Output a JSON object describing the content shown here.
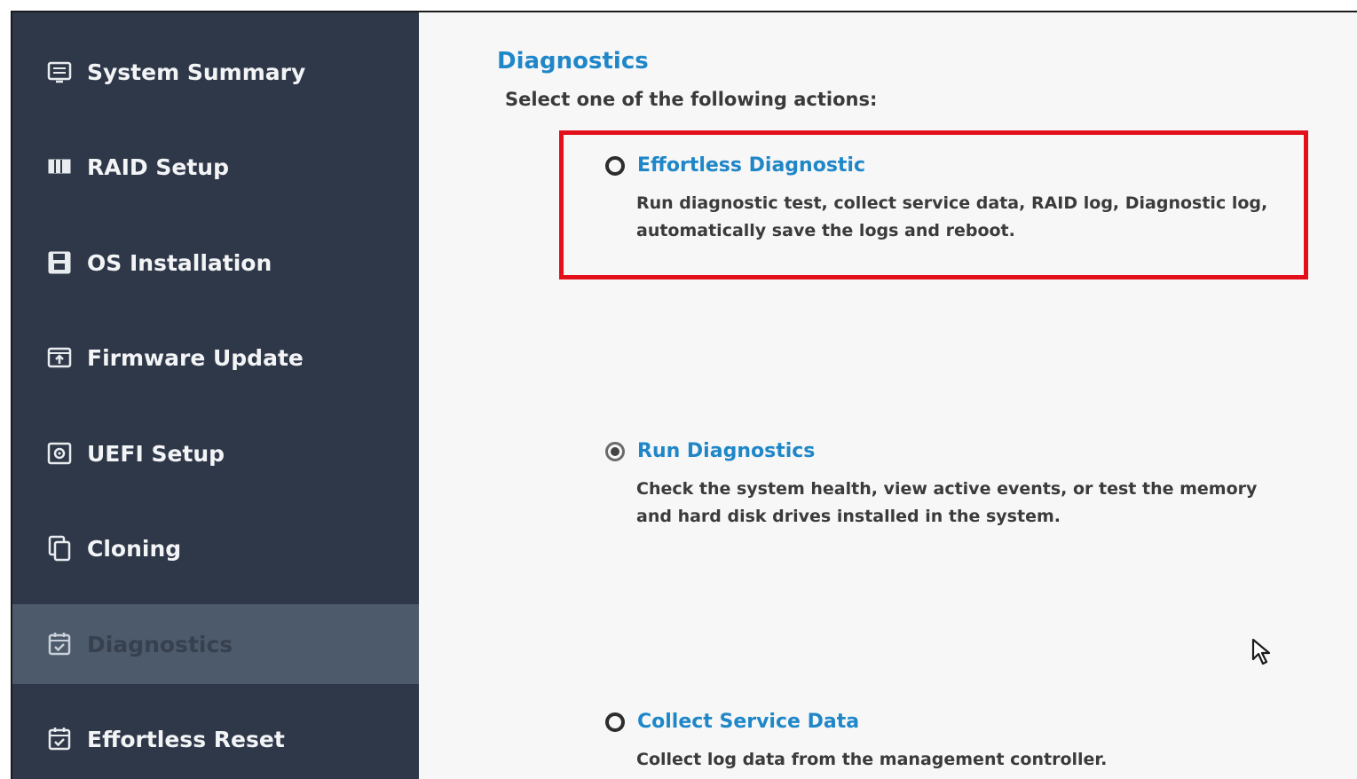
{
  "sidebar": {
    "items": [
      {
        "label": "System Summary",
        "icon": "system-summary-icon",
        "active": false
      },
      {
        "label": "RAID Setup",
        "icon": "raid-icon",
        "active": false
      },
      {
        "label": "OS Installation",
        "icon": "save-disk-icon",
        "active": false
      },
      {
        "label": "Firmware Update",
        "icon": "firmware-update-icon",
        "active": false
      },
      {
        "label": "UEFI Setup",
        "icon": "uefi-setup-icon",
        "active": false
      },
      {
        "label": "Cloning",
        "icon": "copy-icon",
        "active": false
      },
      {
        "label": "Diagnostics",
        "icon": "calendar-check-icon",
        "active": true
      },
      {
        "label": "Effortless Reset",
        "icon": "calendar-check-icon",
        "active": false
      }
    ]
  },
  "main": {
    "title": "Diagnostics",
    "subtitle": "Select one of the following actions:",
    "options": [
      {
        "title": "Effortless Diagnostic",
        "description": "Run diagnostic test, collect service data, RAID log, Diagnostic log, automatically save the logs and reboot.",
        "selected": false,
        "highlighted": true
      },
      {
        "title": "Run Diagnostics",
        "description": "Check the system health, view active events, or test the memory and hard disk drives installed in the system.",
        "selected": true,
        "highlighted": false
      },
      {
        "title": "Collect Service Data",
        "description": "Collect log data from the management controller.",
        "selected": false,
        "highlighted": false
      }
    ]
  },
  "colors": {
    "sidebar_bg": "#2f3849",
    "active_item_bg": "#4c5a6b",
    "accent_blue": "#1f87c8",
    "highlight_red": "#e3101b"
  }
}
